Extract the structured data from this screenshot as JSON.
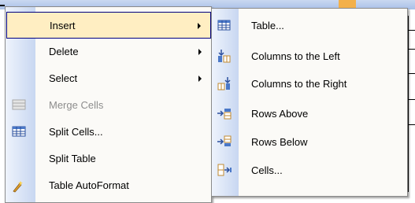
{
  "context_menu": {
    "items": [
      {
        "label": "Insert",
        "icon": "",
        "has_submenu": true,
        "highlighted": true,
        "disabled": false
      },
      {
        "label": "Delete",
        "icon": "",
        "has_submenu": true,
        "highlighted": false,
        "disabled": false
      },
      {
        "label": "Select",
        "icon": "",
        "has_submenu": true,
        "highlighted": false,
        "disabled": false
      },
      {
        "label": "Merge Cells",
        "icon": "merge-cells-icon",
        "has_submenu": false,
        "highlighted": false,
        "disabled": true
      },
      {
        "label": "Split Cells...",
        "icon": "split-cells-icon",
        "has_submenu": false,
        "highlighted": false,
        "disabled": false
      },
      {
        "label": "Split Table",
        "icon": "",
        "has_submenu": false,
        "highlighted": false,
        "disabled": false
      },
      {
        "label": "Table AutoFormat",
        "icon": "autoformat-icon",
        "has_submenu": false,
        "highlighted": false,
        "disabled": false
      }
    ]
  },
  "insert_submenu": {
    "items": [
      {
        "label": "Table...",
        "icon": "table-icon"
      },
      {
        "label": "Columns to the Left",
        "icon": "insert-columns-left-icon"
      },
      {
        "label": "Columns to the Right",
        "icon": "insert-columns-right-icon"
      },
      {
        "label": "Rows Above",
        "icon": "insert-rows-above-icon"
      },
      {
        "label": "Rows Below",
        "icon": "insert-rows-below-icon"
      },
      {
        "label": "Cells...",
        "icon": "insert-cells-icon"
      }
    ]
  },
  "colors": {
    "highlight_fill": "#ffeec2",
    "highlight_border": "#000080",
    "gutter": "#c8d7f1",
    "menu_bg": "#fbfaf7",
    "disabled_text": "#8d8d8d"
  }
}
